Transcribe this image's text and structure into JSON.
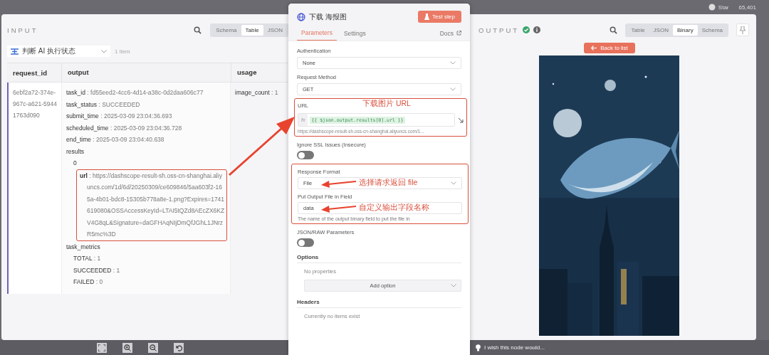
{
  "top_bar": {
    "star_label": "Star",
    "star_count": "65,401"
  },
  "input_panel": {
    "title": "INPUT",
    "view_tabs": [
      {
        "label": "Schema",
        "selected": false
      },
      {
        "label": "Table",
        "selected": true
      },
      {
        "label": "JSON",
        "selected": false
      }
    ],
    "node_select": "判断 AI 执行状态",
    "item_count": "1 item",
    "table": {
      "columns": [
        "request_id",
        "output",
        "usage"
      ],
      "separator": ":",
      "rows": [
        {
          "request_id": "6ebf2a72-374e-967c-a621-59441763d090",
          "output": [
            {
              "key": "task_id",
              "value": "fd55eed2-4cc6-4d14-a38c-0d2daa606c77"
            },
            {
              "key": "task_status",
              "value": "SUCCEEDED"
            },
            {
              "key": "submit_time",
              "value": "2025-03-09 23:04:36.693"
            },
            {
              "key": "scheduled_time",
              "value": "2025-03-09 23:04:36.728"
            },
            {
              "key": "end_time",
              "value": "2025-03-09 23:04:40.638"
            },
            {
              "key": "results",
              "children": [
                {
                  "key": "0",
                  "children": [
                    {
                      "key": "url",
                      "value": "https://dashscope-result-sh.oss-cn-shanghai.aliyuncs.com/1d/6d/20250309/ce609846/5aa603f2-165a-4b01-bdc8-15305b778a8e-1.png?Expires=1741619080&OSSAccessKeyId=LTAI5tQZd8AEcZX6KZV4G8qL&Signature=daGFHAqNIjDmQfJGhL1JNrzR5mc%3D",
                      "highlighted": true
                    }
                  ]
                }
              ]
            },
            {
              "key": "task_metrics",
              "children": [
                {
                  "key": "TOTAL",
                  "value": "1"
                },
                {
                  "key": "SUCCEEDED",
                  "value": "1"
                },
                {
                  "key": "FAILED",
                  "value": "0"
                }
              ]
            }
          ],
          "usage": [
            {
              "key": "image_count",
              "value": "1"
            }
          ]
        }
      ]
    }
  },
  "node_panel": {
    "title": "下载 海报图",
    "test_button": "Test step",
    "tabs": [
      {
        "label": "Parameters",
        "selected": true
      },
      {
        "label": "Settings",
        "selected": false
      }
    ],
    "docs_link": "Docs",
    "authentication": {
      "label": "Authentication",
      "value": "None"
    },
    "request_method": {
      "label": "Request Method",
      "value": "GET"
    },
    "url": {
      "label": "URL",
      "function_label": "fx",
      "expression": "{{ $json.output.results[0].url }}",
      "preview": "https://dashscope-result-sh.oss-cn-shanghai.aliyuncs.com/1...",
      "note": "下载图片 URL"
    },
    "ignore_ssl": {
      "label": "Ignore SSL Issues (Insecure)",
      "on": false
    },
    "response_format": {
      "label": "Response Format",
      "value": "File",
      "note": "选择请求返回 file"
    },
    "output_field": {
      "label": "Put Output File in Field",
      "value": "data",
      "hint": "The name of the output binary field to put the file in",
      "note": "自定义输出字段名称"
    },
    "json_raw": {
      "label": "JSON/RAW Parameters",
      "on": false
    },
    "options": {
      "title": "Options",
      "empty": "No properties",
      "button": "Add option"
    },
    "headers": {
      "title": "Headers",
      "empty": "Currently no items exist"
    }
  },
  "output_panel": {
    "title": "OUTPUT",
    "view_tabs": [
      {
        "label": "Table",
        "selected": false
      },
      {
        "label": "JSON",
        "selected": false
      },
      {
        "label": "Binary",
        "selected": true
      },
      {
        "label": "Schema",
        "selected": false
      }
    ],
    "back_button": "Back to list"
  },
  "bottom_bar": {
    "feedback": "I wish this node would..."
  }
}
